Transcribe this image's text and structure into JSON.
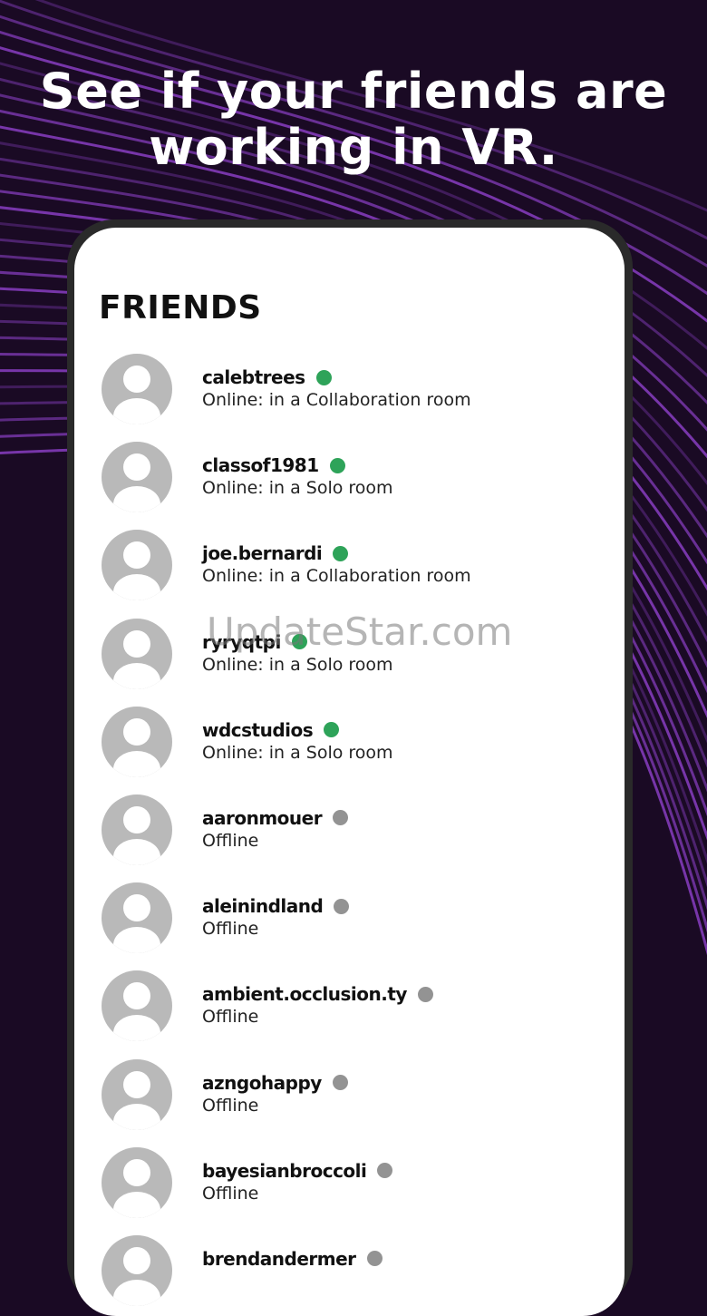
{
  "headline": {
    "line1": "See if your friends are",
    "line2": "working in VR."
  },
  "friends": {
    "title": "FRIENDS",
    "items": [
      {
        "name": "calebtrees",
        "status": "Online: in a Collaboration room",
        "online": true
      },
      {
        "name": "classof1981",
        "status": "Online: in a Solo room",
        "online": true
      },
      {
        "name": "joe.bernardi",
        "status": "Online: in a Collaboration room",
        "online": true
      },
      {
        "name": "ryryqtpi",
        "status": "Online: in a Solo room",
        "online": true
      },
      {
        "name": "wdcstudios",
        "status": "Online: in a Solo room",
        "online": true
      },
      {
        "name": "aaronmouer",
        "status": "Offline",
        "online": false
      },
      {
        "name": "aleinindland",
        "status": "Offline",
        "online": false
      },
      {
        "name": "ambient.occlusion.ty",
        "status": "Offline",
        "online": false
      },
      {
        "name": "azngohappy",
        "status": "Offline",
        "online": false
      },
      {
        "name": "bayesianbroccoli",
        "status": "Offline",
        "online": false
      },
      {
        "name": "brendandermer",
        "status": "",
        "online": false
      }
    ]
  },
  "watermark": "UpdateStar.com",
  "colors": {
    "background": "#1a0a24",
    "accent_lines": "#8a3fc4",
    "online": "#2ea359",
    "offline": "#939393"
  },
  "icons": {
    "avatar": "default-user-avatar-icon",
    "online_indicator": "green-dot-icon",
    "offline_indicator": "gray-dot-icon"
  }
}
